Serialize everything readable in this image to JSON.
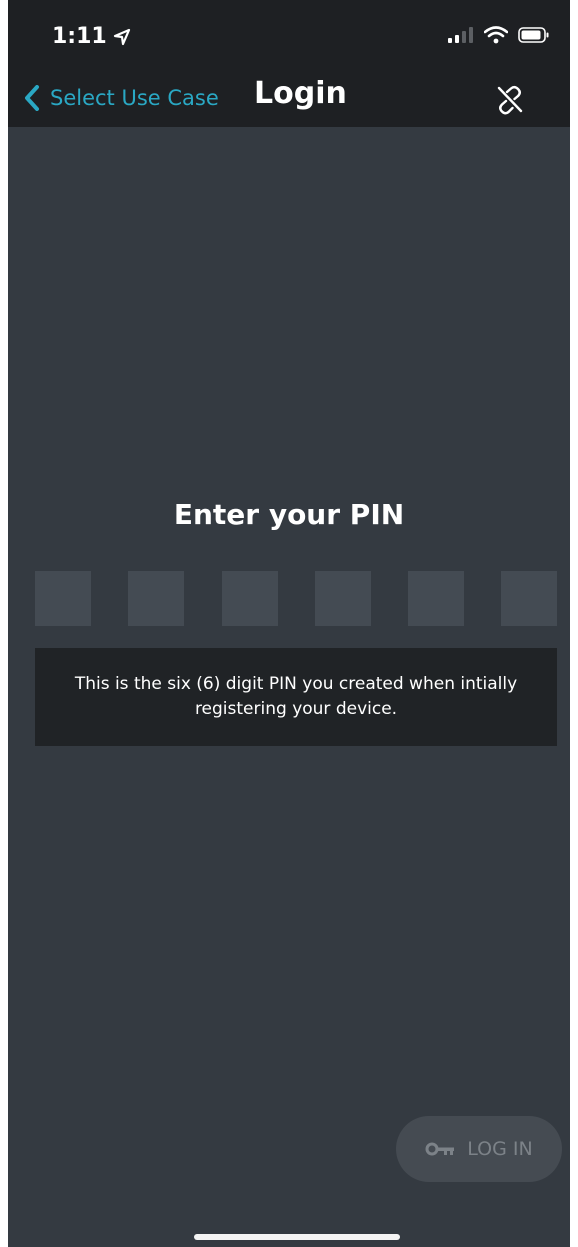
{
  "status_bar": {
    "time": "1:11"
  },
  "nav": {
    "back_label": "Select Use Case",
    "title": "Login"
  },
  "main": {
    "heading": "Enter your PIN",
    "pin_length": 6,
    "hint": "This is the six (6) digit PIN you created when intially registering your device."
  },
  "login_button": {
    "label": "LOG IN"
  },
  "colors": {
    "accent": "#2aa8c4",
    "background": "#343a41",
    "header": "#1e2023",
    "pin_box": "#444b53"
  }
}
